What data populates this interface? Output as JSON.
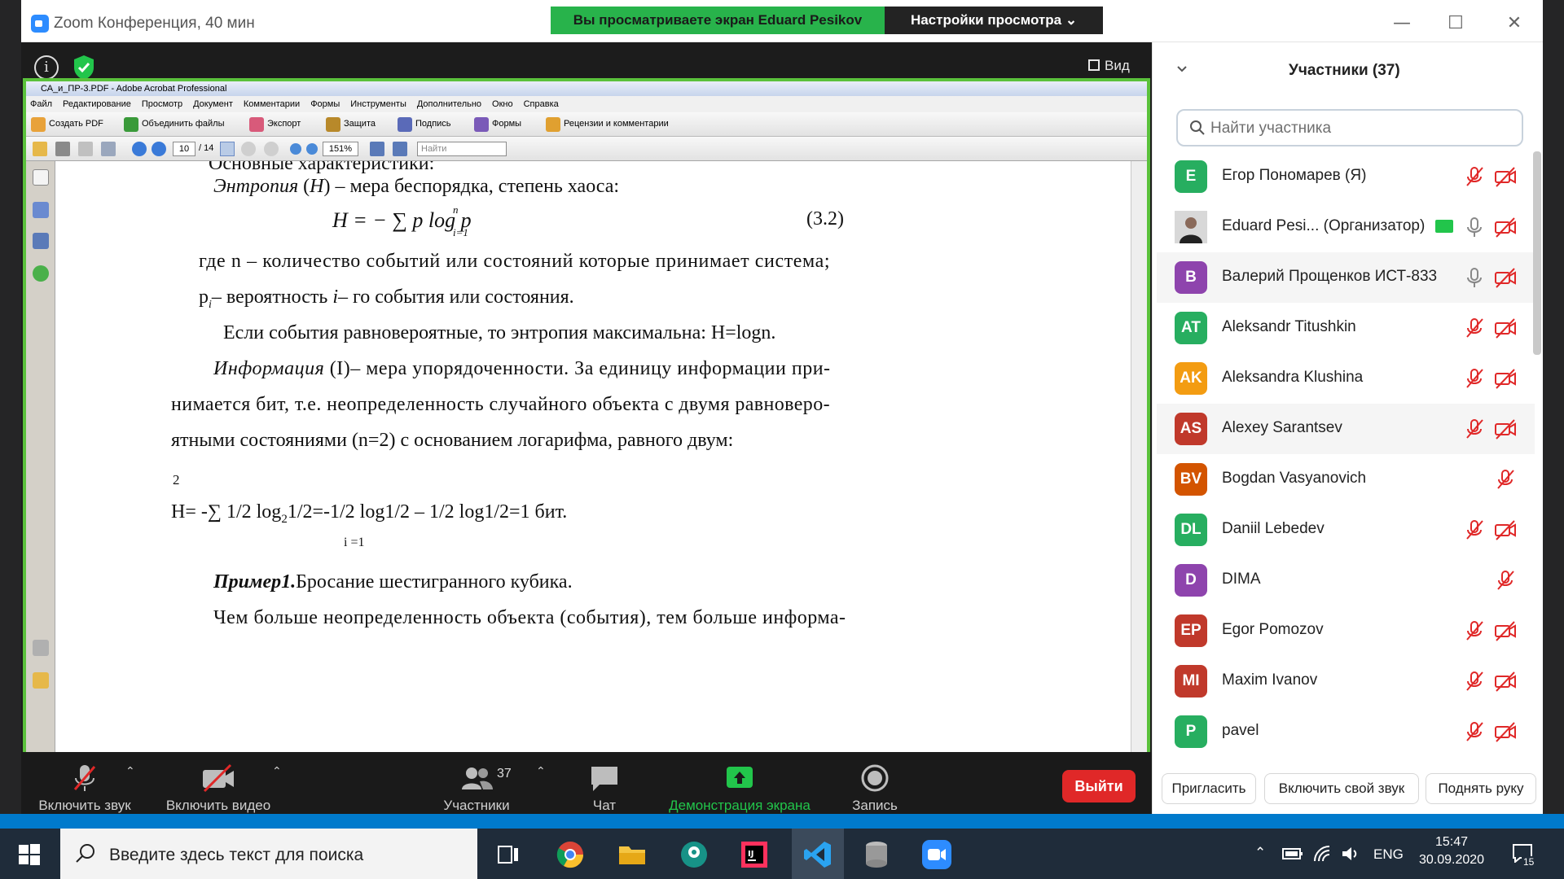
{
  "zoom": {
    "window_title": "Zoom Конференция, 40 мин",
    "share_banner": "Вы просматриваете экран Eduard Pesikov",
    "view_options": "Настройки просмотра ⌄",
    "view_button": "Вид",
    "colors": {
      "green": "#28b34b",
      "blue": "#2d8cff",
      "red": "#e02828"
    }
  },
  "acrobat": {
    "title": "СА_и_ПР-3.PDF - Adobe Acrobat Professional",
    "menu": [
      "Файл",
      "Редактирование",
      "Просмотр",
      "Документ",
      "Комментарии",
      "Формы",
      "Инструменты",
      "Дополнительно",
      "Окно",
      "Справка"
    ],
    "toolbar": {
      "create_pdf": "Создать PDF",
      "combine": "Объединить файлы",
      "export": "Экспорт",
      "protect": "Защита",
      "sign": "Подпись",
      "forms": "Формы",
      "review": "Рецензии и комментарии"
    },
    "page_current": "10",
    "page_total": "/ 14",
    "zoom_level": "151%",
    "find_placeholder": "Найти"
  },
  "document": {
    "line0": "Основные характеристики:",
    "line1_term": "Энтропия",
    "line1_sym": "H",
    "line1_rest": "– мера беспорядка, степень хаоса:",
    "formula": "H = − ∑ p log p",
    "formula_sub_i": "i=1",
    "formula_sup_n": "n",
    "formula_num": "(3.2)",
    "line2": "где n – количество событий или состояний которые принимает система;",
    "line3_a": "p",
    "line3_b": "– вероятность",
    "line3_c": "i",
    "line3_d": "– го события или состояния.",
    "line4": "Если события равновероятные, то энтропия максимальна: H=logn.",
    "line5_term": "Информация",
    "line5_rest": "(I)– мера упорядоченности. За единицу информации при-",
    "line6": "нимается бит, т.е. неопределенность случайного объекта с двумя равноверо-",
    "line7": "ятными состояниями (n=2) с основанием логарифма, равного двум:",
    "sup2": "2",
    "formula2": "H= -∑ 1/2 log",
    "formula2_sub": "2",
    "formula2_rest": "1/2=-1/2 log1/2 – 1/2 log1/2=1 бит.",
    "formula2_index": "i =1",
    "line8_term": "Пример1.",
    "line8_rest": "Бросание шестигранного кубика.",
    "line9": "Чем больше неопределенность объекта (события), тем больше информа-"
  },
  "participants": {
    "title": "Участники (37)",
    "search_placeholder": "Найти участника",
    "list": [
      {
        "initials": "E",
        "name": "Егор Пономарев (Я)",
        "color": "#27ae60",
        "mic": "muted",
        "video": "off"
      },
      {
        "initials": "",
        "name": "Eduard Pesi...  (Организатор)",
        "color": "#555555",
        "mic": "on",
        "video": "off",
        "photo": true
      },
      {
        "initials": "B",
        "name": "Валерий Прощенков ИСТ-833",
        "color": "#8e44ad",
        "mic": "on",
        "video": "off"
      },
      {
        "initials": "AT",
        "name": "Aleksandr Titushkin",
        "color": "#27ae60",
        "mic": "muted",
        "video": "off"
      },
      {
        "initials": "AK",
        "name": "Aleksandra Klushina",
        "color": "#f39c12",
        "mic": "muted",
        "video": "off"
      },
      {
        "initials": "AS",
        "name": "Alexey Sarantsev",
        "color": "#c0392b",
        "mic": "muted",
        "video": "off"
      },
      {
        "initials": "BV",
        "name": "Bogdan Vasyanovich",
        "color": "#d35400",
        "mic": "muted",
        "video": "none"
      },
      {
        "initials": "DL",
        "name": "Daniil Lebedev",
        "color": "#27ae60",
        "mic": "muted",
        "video": "off"
      },
      {
        "initials": "D",
        "name": "DIMA",
        "color": "#8e44ad",
        "mic": "muted",
        "video": "none"
      },
      {
        "initials": "EP",
        "name": "Egor Pomozov",
        "color": "#c0392b",
        "mic": "muted",
        "video": "off"
      },
      {
        "initials": "MI",
        "name": "Maxim Ivanov",
        "color": "#c0392b",
        "mic": "muted",
        "video": "off"
      },
      {
        "initials": "P",
        "name": "pavel",
        "color": "#27ae60",
        "mic": "muted",
        "video": "off"
      }
    ],
    "invite": "Пригласить",
    "unmute_self": "Включить свой звук",
    "raise_hand": "Поднять руку"
  },
  "meeting_toolbar": {
    "audio": "Включить звук",
    "video": "Включить видео",
    "participants": "Участники",
    "participants_count": "37",
    "chat": "Чат",
    "share": "Демонстрация экрана",
    "record": "Запись",
    "leave": "Выйти"
  },
  "taskbar": {
    "search_placeholder": "Введите здесь текст для поиска",
    "lang": "ENG",
    "time": "15:47",
    "date": "30.09.2020",
    "notifications": "15"
  }
}
